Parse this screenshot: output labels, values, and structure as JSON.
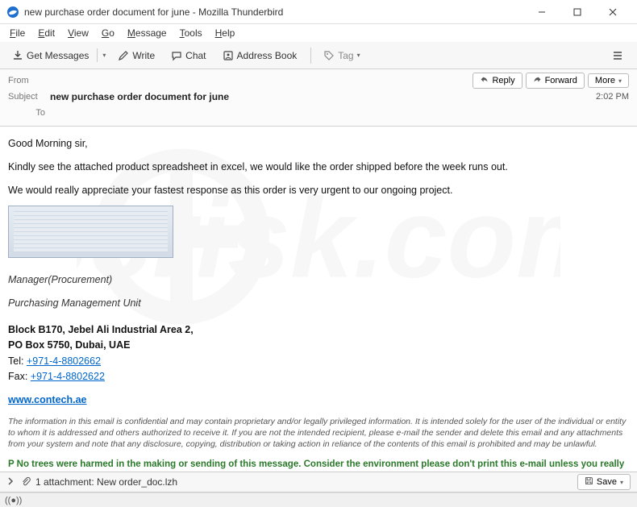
{
  "window": {
    "title": "new purchase order document for june - Mozilla Thunderbird"
  },
  "menu": {
    "file": "File",
    "edit": "Edit",
    "view": "View",
    "go": "Go",
    "message": "Message",
    "tools": "Tools",
    "help": "Help"
  },
  "toolbar": {
    "get_messages": "Get Messages",
    "write": "Write",
    "chat": "Chat",
    "address_book": "Address Book",
    "tag": "Tag"
  },
  "envelope": {
    "from_label": "From",
    "from_value": "",
    "subject_label": "Subject",
    "subject_value": "new purchase order document for june",
    "to_label": "To",
    "to_value": "",
    "reply": "Reply",
    "forward": "Forward",
    "more": "More",
    "time": "2:02 PM"
  },
  "body": {
    "greeting": "Good Morning sir,",
    "p1": "Kindly see the attached product spreadsheet in excel, we would like the order shipped before the week runs out.",
    "p2": "We would really appreciate your fastest response as this order is very urgent to our ongoing project.",
    "sig_title": "Manager(Procurement)",
    "sig_unit": "Purchasing Management Unit",
    "addr1": "Block B170, Jebel Ali Industrial Area 2,",
    "addr2": "PO Box 5750, Dubai, UAE",
    "tel_label": "Tel: ",
    "tel": "+971-4-8802662",
    "fax_label": "Fax: ",
    "fax": "+971-4-8802622",
    "website": "www.contech.ae",
    "disclaimer": "The information in this email is confidential and may contain proprietary and/or legally privileged information. It is intended solely for the user of the individual or entity to whom it is addressed and others authorized to receive it. If you are not the intended recipient, please e-mail the sender and delete this email and any attachments from your system and note that any disclosure, copying, distribution or taking action in reliance of the contents of this email is prohibited and may be unlawful.",
    "eco": "P No trees were harmed in the making or sending of this message. Consider the environment please don't print this e-mail unless you really need to"
  },
  "attachment": {
    "text": "1 attachment: New order_doc.lzh",
    "save": "Save"
  }
}
